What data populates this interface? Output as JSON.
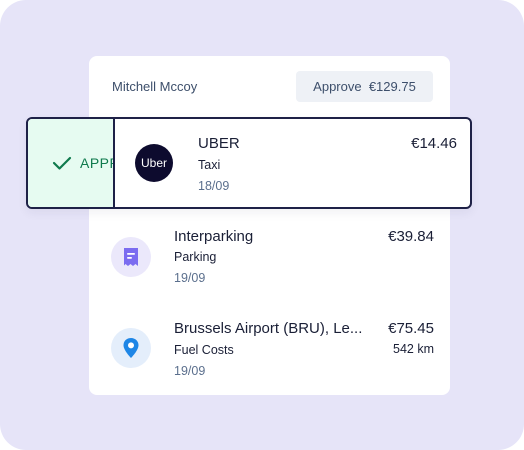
{
  "report": {
    "employee_name": "Mitchell Mccoy",
    "approve_label": "Approve",
    "approve_amount": "€129.75"
  },
  "swipe": {
    "action_label": "APPROVE",
    "colors": {
      "background": "#e6fbf1",
      "text": "#0f7a4d",
      "border": "#1e2147"
    }
  },
  "expenses": [
    {
      "merchant": "UBER",
      "logo_text": "Uber",
      "category": "Taxi",
      "date": "18/09",
      "amount": "€14.46"
    },
    {
      "merchant": "Interparking",
      "icon": "receipt-icon",
      "category": "Parking",
      "date": "19/09",
      "amount": "€39.84"
    },
    {
      "merchant": "Brussels Airport (BRU), Le...",
      "icon": "location-pin-icon",
      "category": "Fuel Costs",
      "date": "19/09",
      "amount": "€75.45",
      "distance": "542 km"
    }
  ],
  "colors": {
    "page_background": "#e6e4f8",
    "card_background": "#ffffff",
    "accent_purple": "#7b6cf0",
    "accent_blue": "#1e86e6"
  }
}
